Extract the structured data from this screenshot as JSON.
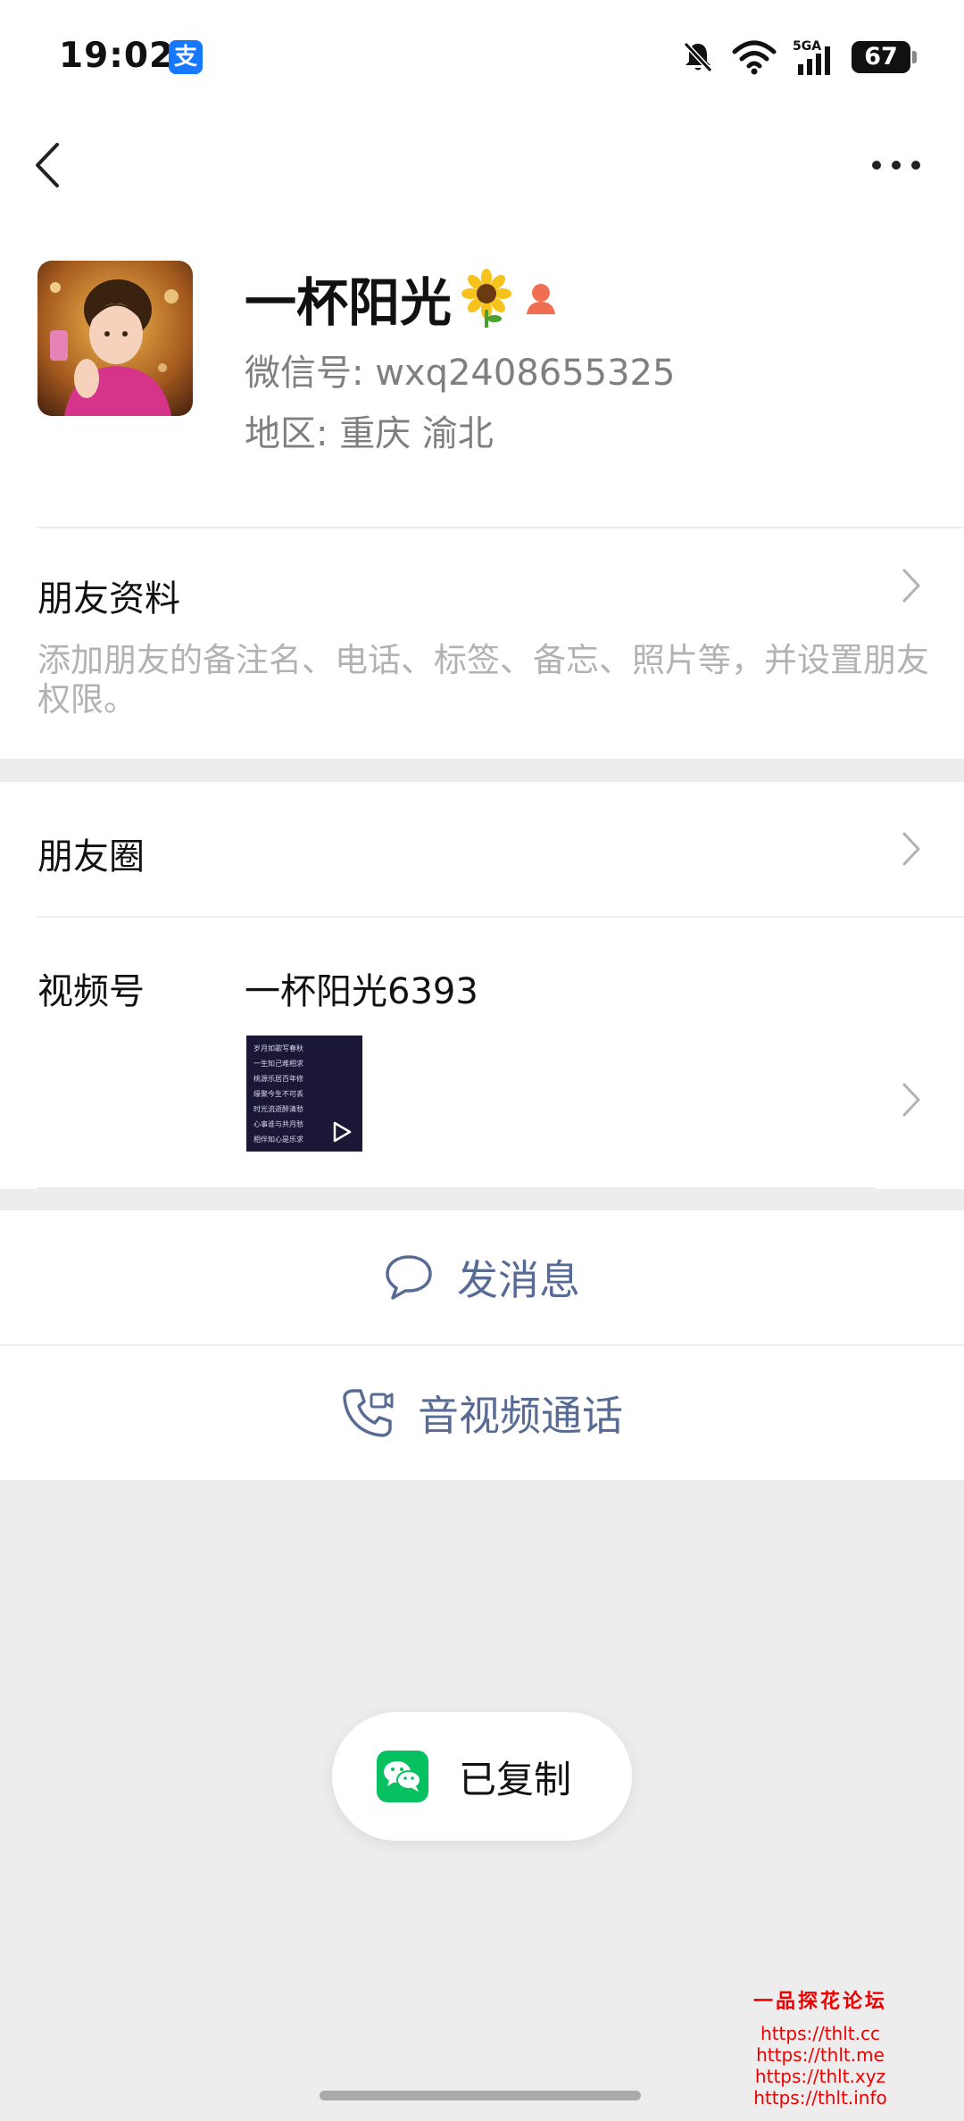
{
  "status_bar": {
    "time": "19:02",
    "alipay_glyph": "支",
    "network": "5GA",
    "battery": "67"
  },
  "profile": {
    "name": "一杯阳光",
    "wechat_id": "微信号: wxq2408655325",
    "region": "地区: 重庆  渝北"
  },
  "friend_info": {
    "title": "朋友资料",
    "description": "添加朋友的备注名、电话、标签、备忘、照片等，并设置朋友权限。"
  },
  "moments": {
    "title": "朋友圈"
  },
  "channels": {
    "title": "视频号",
    "name": "一杯阳光6393",
    "thumb_lines": [
      "岁月如歌写春秋",
      "一生知己难相求",
      "桃源乐居百年修",
      "缘聚今生不可丢",
      "时光流逝醉清愁",
      "心事谁与共月愁",
      "相伴知心是乐求"
    ]
  },
  "actions": {
    "message": "发消息",
    "call": "音视频通话"
  },
  "toast": {
    "label": "已复制"
  },
  "watermark": {
    "title": "一品探花论坛",
    "links": [
      "https://thlt.cc",
      "https://thlt.me",
      "https://thlt.xyz",
      "https://thlt.info"
    ]
  },
  "colors": {
    "link_blue": "#576b95",
    "wechat_green": "#07c160",
    "alipay_blue": "#1677ff",
    "watermark_red": "#e00000"
  },
  "icons": [
    "back-icon",
    "more-icon",
    "female-icon",
    "sunflower-icon",
    "chevron-right-icon",
    "chat-bubble-icon",
    "video-call-icon",
    "wechat-icon",
    "mute-icon",
    "wifi-icon",
    "signal-icon",
    "battery-icon",
    "play-icon"
  ]
}
